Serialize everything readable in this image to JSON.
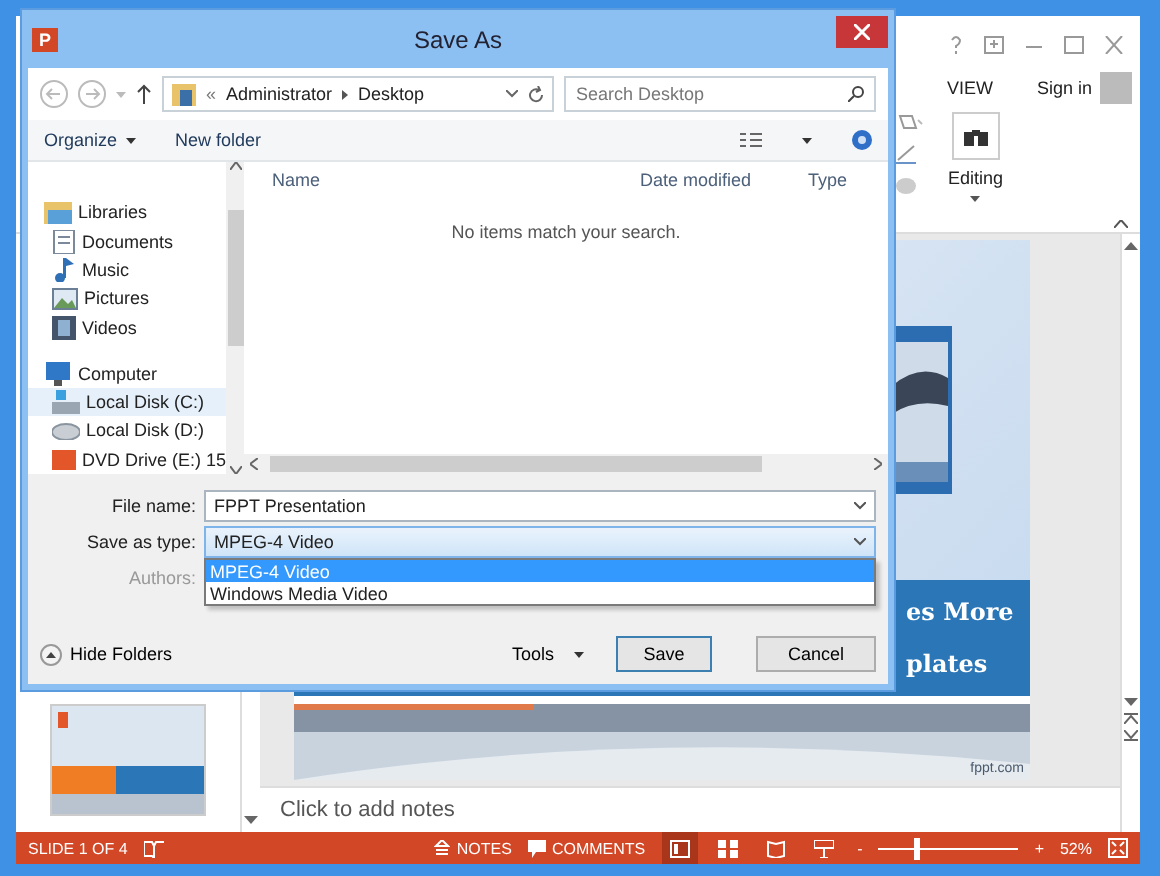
{
  "powerpoint": {
    "ribbon_tab": "VIEW",
    "sign_in": "Sign in",
    "editing_group": "Editing",
    "slide": {
      "lines": [
        "es More",
        "plates"
      ],
      "watermark": "fppt.com"
    },
    "notes_placeholder": "Click to add notes",
    "status_bar": {
      "slide_counter": "SLIDE 1 OF 4",
      "notes": "NOTES",
      "comments": "COMMENTS",
      "view_buttons": [
        {
          "selected": true
        },
        {
          "selected": false
        },
        {
          "selected": false
        },
        {
          "selected": false
        }
      ],
      "zoom_out": "-",
      "zoom_slider": {
        "level": 0.25
      },
      "zoom_in": "+",
      "zoom": "52%"
    }
  },
  "dialog": {
    "logo_letter": "P",
    "title": "Save As",
    "breadcrumb_prefix": "«",
    "breadcrumb": [
      "Administrator",
      "Desktop"
    ],
    "search": {
      "placeholder": "Search Desktop"
    },
    "toolbar": [
      "Organize",
      "New folder"
    ],
    "nav": [
      {
        "label": "Libraries",
        "children": [
          {
            "label": "Documents",
            "selected": false
          },
          {
            "label": "Music",
            "selected": false
          },
          {
            "label": "Pictures",
            "selected": false
          },
          {
            "label": "Videos",
            "selected": false
          }
        ]
      },
      {
        "label": "Computer",
        "children": [
          {
            "label": "Local Disk (C:)",
            "selected": true
          },
          {
            "label": "Local Disk (D:)",
            "selected": false
          },
          {
            "label": "DVD Drive (E:) 15",
            "selected": false
          }
        ]
      }
    ],
    "columns": [
      "Name",
      "Date modified",
      "Type"
    ],
    "empty_message": "No items match your search.",
    "file_name": {
      "label": "File name:",
      "value": "FPPT Presentation"
    },
    "save_type": {
      "label": "Save as type:",
      "value": "MPEG-4 Video",
      "options": [
        {
          "label": "MPEG-4 Video",
          "selected": true
        },
        {
          "label": "Windows Media Video",
          "selected": false
        }
      ]
    },
    "authors": {
      "label": "Authors:",
      "disabled": true
    },
    "hide_folders": "Hide Folders",
    "tools": "Tools",
    "buttons": [
      "Save",
      "Cancel"
    ]
  }
}
